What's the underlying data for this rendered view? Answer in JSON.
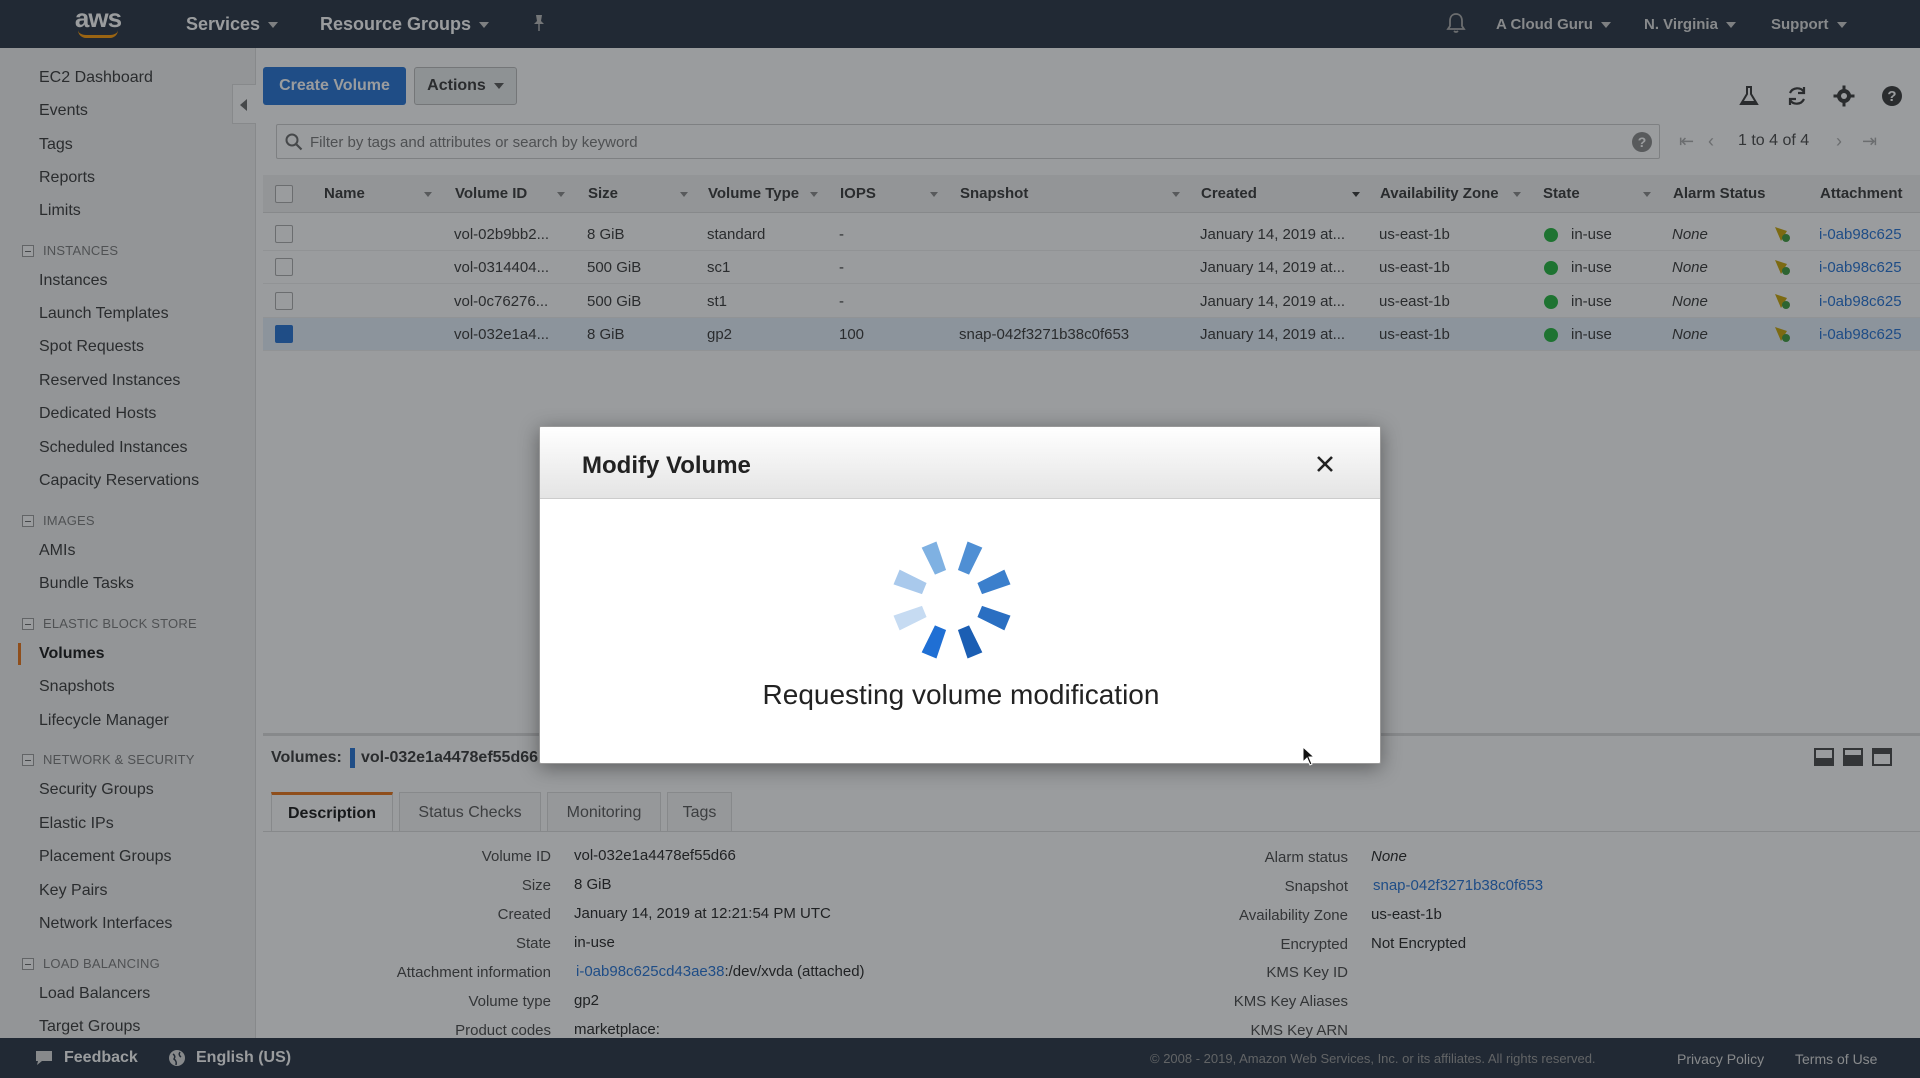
{
  "topnav": {
    "logo": "aws",
    "services": "Services",
    "resource_groups": "Resource Groups",
    "pin_icon": "pin-icon",
    "bell_icon": "bell-icon",
    "account": "A Cloud Guru",
    "region": "N. Virginia",
    "support": "Support"
  },
  "sidebar": {
    "top_items": [
      "EC2 Dashboard",
      "Events",
      "Tags",
      "Reports",
      "Limits"
    ],
    "sections": [
      {
        "title": "INSTANCES",
        "items": [
          "Instances",
          "Launch Templates",
          "Spot Requests",
          "Reserved Instances",
          "Dedicated Hosts",
          "Scheduled Instances",
          "Capacity Reservations"
        ]
      },
      {
        "title": "IMAGES",
        "items": [
          "AMIs",
          "Bundle Tasks"
        ]
      },
      {
        "title": "ELASTIC BLOCK STORE",
        "items": [
          "Volumes",
          "Snapshots",
          "Lifecycle Manager"
        ]
      },
      {
        "title": "NETWORK & SECURITY",
        "items": [
          "Security Groups",
          "Elastic IPs",
          "Placement Groups",
          "Key Pairs",
          "Network Interfaces"
        ]
      },
      {
        "title": "LOAD BALANCING",
        "items": [
          "Load Balancers",
          "Target Groups"
        ]
      }
    ],
    "active_item": "Volumes"
  },
  "toolbar": {
    "create_volume": "Create Volume",
    "actions": "Actions",
    "icons": [
      "flask-icon",
      "refresh-icon",
      "gear-icon",
      "help-icon"
    ]
  },
  "search": {
    "placeholder": "Filter by tags and attributes or search by keyword",
    "value": ""
  },
  "pagination": {
    "text": "1 to 4 of 4"
  },
  "table": {
    "columns": [
      "Name",
      "Volume ID",
      "Size",
      "Volume Type",
      "IOPS",
      "Snapshot",
      "Created",
      "Availability Zone",
      "State",
      "Alarm Status",
      "Attachment"
    ],
    "rows": [
      {
        "name": "",
        "volume_id": "vol-02b9bb2...",
        "size": "8 GiB",
        "type": "standard",
        "iops": "-",
        "snapshot": "",
        "created": "January 14, 2019 at...",
        "az": "us-east-1b",
        "state": "in-use",
        "alarm": "None",
        "attachment": "i-0ab98c625",
        "selected": false
      },
      {
        "name": "",
        "volume_id": "vol-0314404...",
        "size": "500 GiB",
        "type": "sc1",
        "iops": "-",
        "snapshot": "",
        "created": "January 14, 2019 at...",
        "az": "us-east-1b",
        "state": "in-use",
        "alarm": "None",
        "attachment": "i-0ab98c625",
        "selected": false
      },
      {
        "name": "",
        "volume_id": "vol-0c76276...",
        "size": "500 GiB",
        "type": "st1",
        "iops": "-",
        "snapshot": "",
        "created": "January 14, 2019 at...",
        "az": "us-east-1b",
        "state": "in-use",
        "alarm": "None",
        "attachment": "i-0ab98c625",
        "selected": false
      },
      {
        "name": "",
        "volume_id": "vol-032e1a4...",
        "size": "8 GiB",
        "type": "gp2",
        "iops": "100",
        "snapshot": "snap-042f3271b38c0f653",
        "created": "January 14, 2019 at...",
        "az": "us-east-1b",
        "state": "in-use",
        "alarm": "None",
        "attachment": "i-0ab98c625",
        "selected": true
      }
    ]
  },
  "details": {
    "label": "Volumes:",
    "selected_volume": "vol-032e1a4478ef55d66",
    "tabs": [
      "Description",
      "Status Checks",
      "Monitoring",
      "Tags"
    ],
    "active_tab": "Description",
    "left": [
      {
        "label": "Volume ID",
        "value": "vol-032e1a4478ef55d66"
      },
      {
        "label": "Size",
        "value": "8 GiB"
      },
      {
        "label": "Created",
        "value": "January 14, 2019 at 12:21:54 PM UTC"
      },
      {
        "label": "State",
        "value": "in-use"
      },
      {
        "label": "Attachment information",
        "value_link": "i-0ab98c625cd43ae38",
        "value_rest": ":/dev/xvda (attached)"
      },
      {
        "label": "Volume type",
        "value": "gp2"
      },
      {
        "label": "Product codes",
        "value": "marketplace:"
      }
    ],
    "right": [
      {
        "label": "Alarm status",
        "value": "None"
      },
      {
        "label": "Snapshot",
        "value": "snap-042f3271b38c0f653"
      },
      {
        "label": "Availability Zone",
        "value": "us-east-1b"
      },
      {
        "label": "Encrypted",
        "value": "Not Encrypted"
      },
      {
        "label": "KMS Key ID",
        "value": ""
      },
      {
        "label": "KMS Key Aliases",
        "value": ""
      },
      {
        "label": "KMS Key ARN",
        "value": ""
      }
    ]
  },
  "modal": {
    "title": "Modify Volume",
    "message": "Requesting volume modification",
    "close_icon": "close-icon",
    "spinner_icon": "loading-spinner-icon"
  },
  "footer": {
    "feedback": "Feedback",
    "language": "English (US)",
    "copyright": "© 2008 - 2019, Amazon Web Services, Inc. or its affiliates. All rights reserved.",
    "privacy": "Privacy Policy",
    "terms": "Terms of Use"
  },
  "colors": {
    "nav_bg": "#232f3e",
    "primary": "#1f6fd4",
    "accent": "#ec7211",
    "state_green": "#1eb53a"
  }
}
